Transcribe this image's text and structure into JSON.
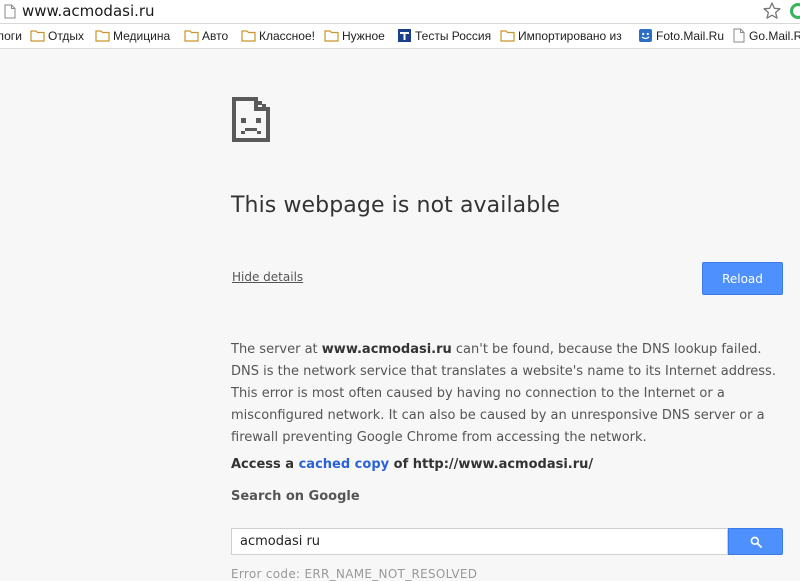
{
  "omnibox": {
    "url": "www.acmodasi.ru"
  },
  "bookmarks": [
    {
      "label": "логи",
      "icon": "none"
    },
    {
      "label": "Отдых",
      "icon": "folder-icon"
    },
    {
      "label": "Медицина",
      "icon": "folder-icon"
    },
    {
      "label": "Авто",
      "icon": "folder-icon"
    },
    {
      "label": "Классное!",
      "icon": "folder-icon"
    },
    {
      "label": "Нужное",
      "icon": "folder-icon"
    },
    {
      "label": "Тесты Россия",
      "icon": "site-favicon"
    },
    {
      "label": "Импортировано из",
      "icon": "folder-icon"
    },
    {
      "label": "Foto.Mail.Ru",
      "icon": "foto-mail-favicon"
    },
    {
      "label": "Go.Mail.Ru",
      "icon": "page-icon"
    }
  ],
  "error": {
    "headline": "This webpage is not available",
    "hide_details": "Hide details",
    "reload": "Reload",
    "details": {
      "prefix": "The server at ",
      "host": "www.acmodasi.ru",
      "suffix": " can't be found, because the DNS lookup failed. DNS is the network service that translates a website's name to its Internet address. This error is most often caused by having no connection to the Internet or a misconfigured network. It can also be caused by an unresponsive DNS server or a firewall preventing Google Chrome from accessing the network."
    },
    "access": {
      "prefix": "Access a ",
      "link": "cached copy",
      "suffix": " of http://www.acmodasi.ru/"
    },
    "search_title": "Search on Google",
    "search_value": "acmodasi ru",
    "error_code": "Error code: ERR_NAME_NOT_RESOLVED"
  },
  "colors": {
    "accent": "#4d90fe",
    "link": "#2a63d5",
    "folder": "#e2b34a"
  }
}
